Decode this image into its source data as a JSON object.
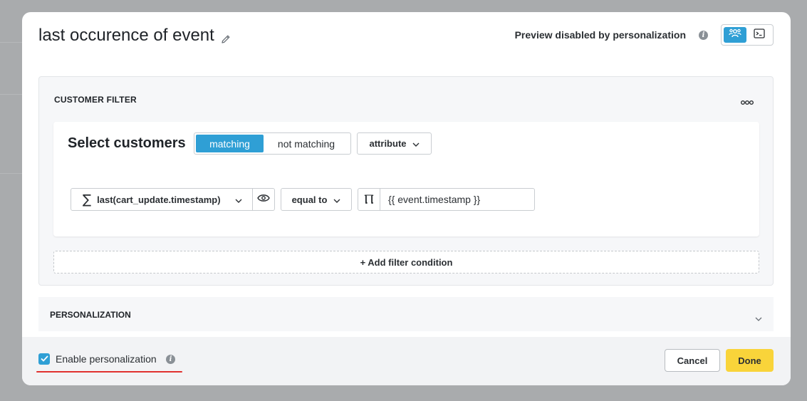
{
  "modal": {
    "title": "last occurence of event",
    "preview_text": "Preview disabled by personalization"
  },
  "icons": {
    "edit": "pencil-icon",
    "info": "info-icon",
    "personalization_mode": "people-network-icon",
    "code_mode": "terminal-icon",
    "more": "more-horizontal-icon",
    "dropdown": "chevron-down-icon",
    "aggregate": "sigma-icon",
    "preview": "eye-icon",
    "text_type": "text-type-icon",
    "checkbox": "checkmark-icon"
  },
  "customer_filter": {
    "header": "CUSTOMER FILTER",
    "select_title": "Select customers",
    "segment_options": [
      "matching",
      "not matching"
    ],
    "segment_selected": "matching",
    "type_dropdown": "attribute",
    "condition": {
      "aggregate_symbol": "∑",
      "expression": "last(cart_update.timestamp)",
      "operator": "equal to",
      "value_type_symbol": "Ⲡ",
      "value": "{{ event.timestamp }}"
    },
    "add_condition_label": "+ Add filter condition"
  },
  "personalization": {
    "header": "PERSONALIZATION"
  },
  "footer": {
    "checkbox_label": "Enable personalization",
    "checkbox_checked": true,
    "cancel_label": "Cancel",
    "done_label": "Done"
  },
  "colors": {
    "accent": "#2f9fd5",
    "primary_button": "#f9d43a",
    "annotation_underline": "#e0312f"
  }
}
